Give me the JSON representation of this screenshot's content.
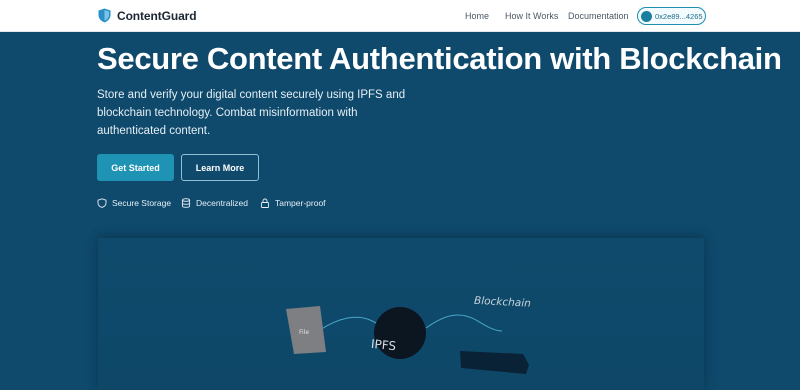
{
  "nav": {
    "brand": "ContentGuard",
    "links": [
      "Home",
      "How It Works",
      "Documentation"
    ],
    "wallet": "0x2e89...4265"
  },
  "hero": {
    "title": "Secure Content Authentication with Blockchain",
    "subtitle": "Store and verify your digital content securely using IPFS and blockchain technology. Combat misinformation with authenticated content.",
    "primary_button": "Get Started",
    "secondary_button": "Learn More",
    "features": [
      {
        "label": "Secure Storage",
        "icon": "shield-icon"
      },
      {
        "label": "Decentralized",
        "icon": "database-icon"
      },
      {
        "label": "Tamper-proof",
        "icon": "lock-icon"
      }
    ]
  },
  "visual": {
    "file_label": "File",
    "ipfs_label": "IPFS",
    "blockchain_label": "Blockchain"
  },
  "colors": {
    "background": "#0f4a6d",
    "accent": "#1f93b4",
    "nav_background": "#ffffff"
  }
}
